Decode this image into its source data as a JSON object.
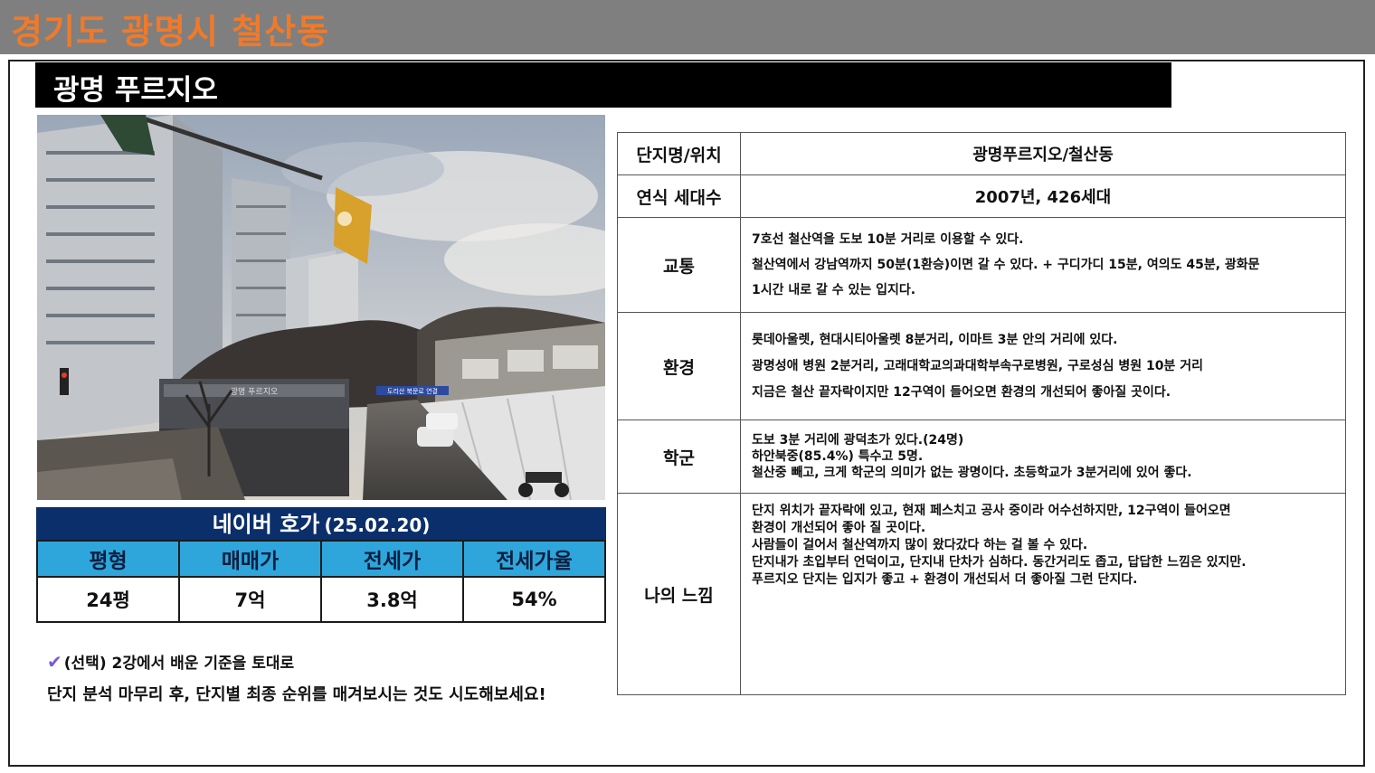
{
  "header": {
    "title": "경기도 광명시 철산동"
  },
  "complex": {
    "name": "광명 푸르지오"
  },
  "photo": {
    "sign_text": "광명 푸르지오",
    "banner_text": "도리산 북문로 연결"
  },
  "price": {
    "title": "네이버 호가",
    "date": "(25.02.20)",
    "headers": [
      "평형",
      "매매가",
      "전세가",
      "전세가율"
    ],
    "values": [
      "24평",
      "7억",
      "3.8억",
      "54%"
    ]
  },
  "notes": {
    "line1": "(선택) 2강에서 배운 기준을 토대로",
    "line2": "단지 분석 마무리 후, 단지별 최종 순위를 매겨보시는 것도 시도해보세요!"
  },
  "info": {
    "name_label": "단지명/위치",
    "name_value": "광명푸르지오/철산동",
    "year_label": "연식 세대수",
    "year_value": "2007년, 426세대",
    "transport_label": "교통",
    "transport_lines": [
      "7호선 철산역을 도보 10분 거리로 이용할 수 있다.",
      "철산역에서 강남역까지 50분(1환승)이면 갈 수 있다. + 구디가디 15분, 여의도 45분, 광화문",
      "1시간 내로 갈 수 있는 입지다."
    ],
    "env_label": "환경",
    "env_lines": [
      "롯데아울렛, 현대시티아울렛 8분거리, 이마트 3분 안의 거리에 있다.",
      "광명성애 병원 2분거리, 고래대학교의과대학부속구로병원, 구로성심 병원 10분 거리",
      "지금은 철산 끝자락이지만 12구역이 들어오면 환경의 개선되어 좋아질 곳이다."
    ],
    "school_label": "학군",
    "school_lines": [
      "도보 3분 거리에 광덕초가 있다.(24명)",
      "하안북중(85.4%) 특수고 5명.",
      "철산중 빼고, 크게 학군의 의미가 없는 광명이다. 초등학교가 3분거리에 있어 좋다."
    ],
    "feeling_label": "나의 느낌",
    "feeling_lines": [
      " 단지 위치가 끝자락에 있고, 현재 페스치고 공사 중이라 어수선하지만, 12구역이 들어오면",
      "환경이 개선되어 좋아 질 곳이다.",
      "사람들이 걸어서 철산역까지 많이 왔다갔다 하는 걸 볼 수 있다.",
      "단지내가 초입부터 언덕이고, 단지내 단차가 심하다. 동간거리도 좁고, 답답한 느낌은 있지만.",
      "푸르지오 단지는 입지가 좋고 + 환경이 개선되서 더 좋아질 그런 단지다."
    ]
  },
  "colors": {
    "header_bg": "#7f7f7f",
    "header_text": "#f07a2a",
    "price_title_bg": "#0b2f6b",
    "price_header_bg": "#2ea6dc"
  }
}
